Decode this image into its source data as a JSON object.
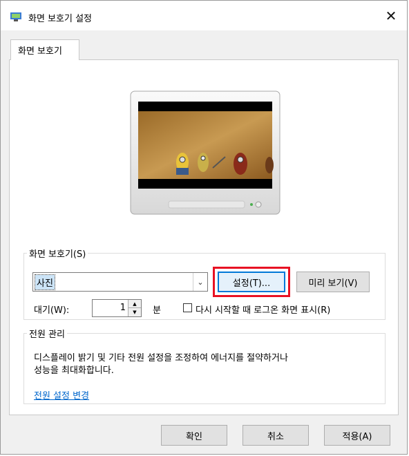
{
  "window": {
    "title": "화면 보호기 설정",
    "title_icon": "display-settings-icon",
    "close_glyph": "✕"
  },
  "tabs": [
    {
      "label": "화면 보호기",
      "active": true
    }
  ],
  "preview": {
    "description": "monitor preview showing screensaver photo"
  },
  "screensaver_group": {
    "legend": "화면 보호기(S)",
    "selected": "사진",
    "settings_button": "설정(T)...",
    "preview_button": "미리 보기(V)",
    "wait_label": "대기(W):",
    "wait_value": "1",
    "wait_unit": "분",
    "resume_checkbox_label": "다시 시작할 때 로그온 화면 표시(R)",
    "resume_checked": false
  },
  "power_group": {
    "legend": "전원 관리",
    "description": "디스플레이 밝기 및 기타 전원 설정을 조정하여 에너지를 절약하거나\n성능을 최대화합니다.",
    "link": "전원 설정 변경"
  },
  "footer": {
    "ok": "확인",
    "cancel": "취소",
    "apply": "적용(A)"
  },
  "colors": {
    "accent": "#0078d7",
    "highlight": "#e81123",
    "link": "#0066cc"
  }
}
